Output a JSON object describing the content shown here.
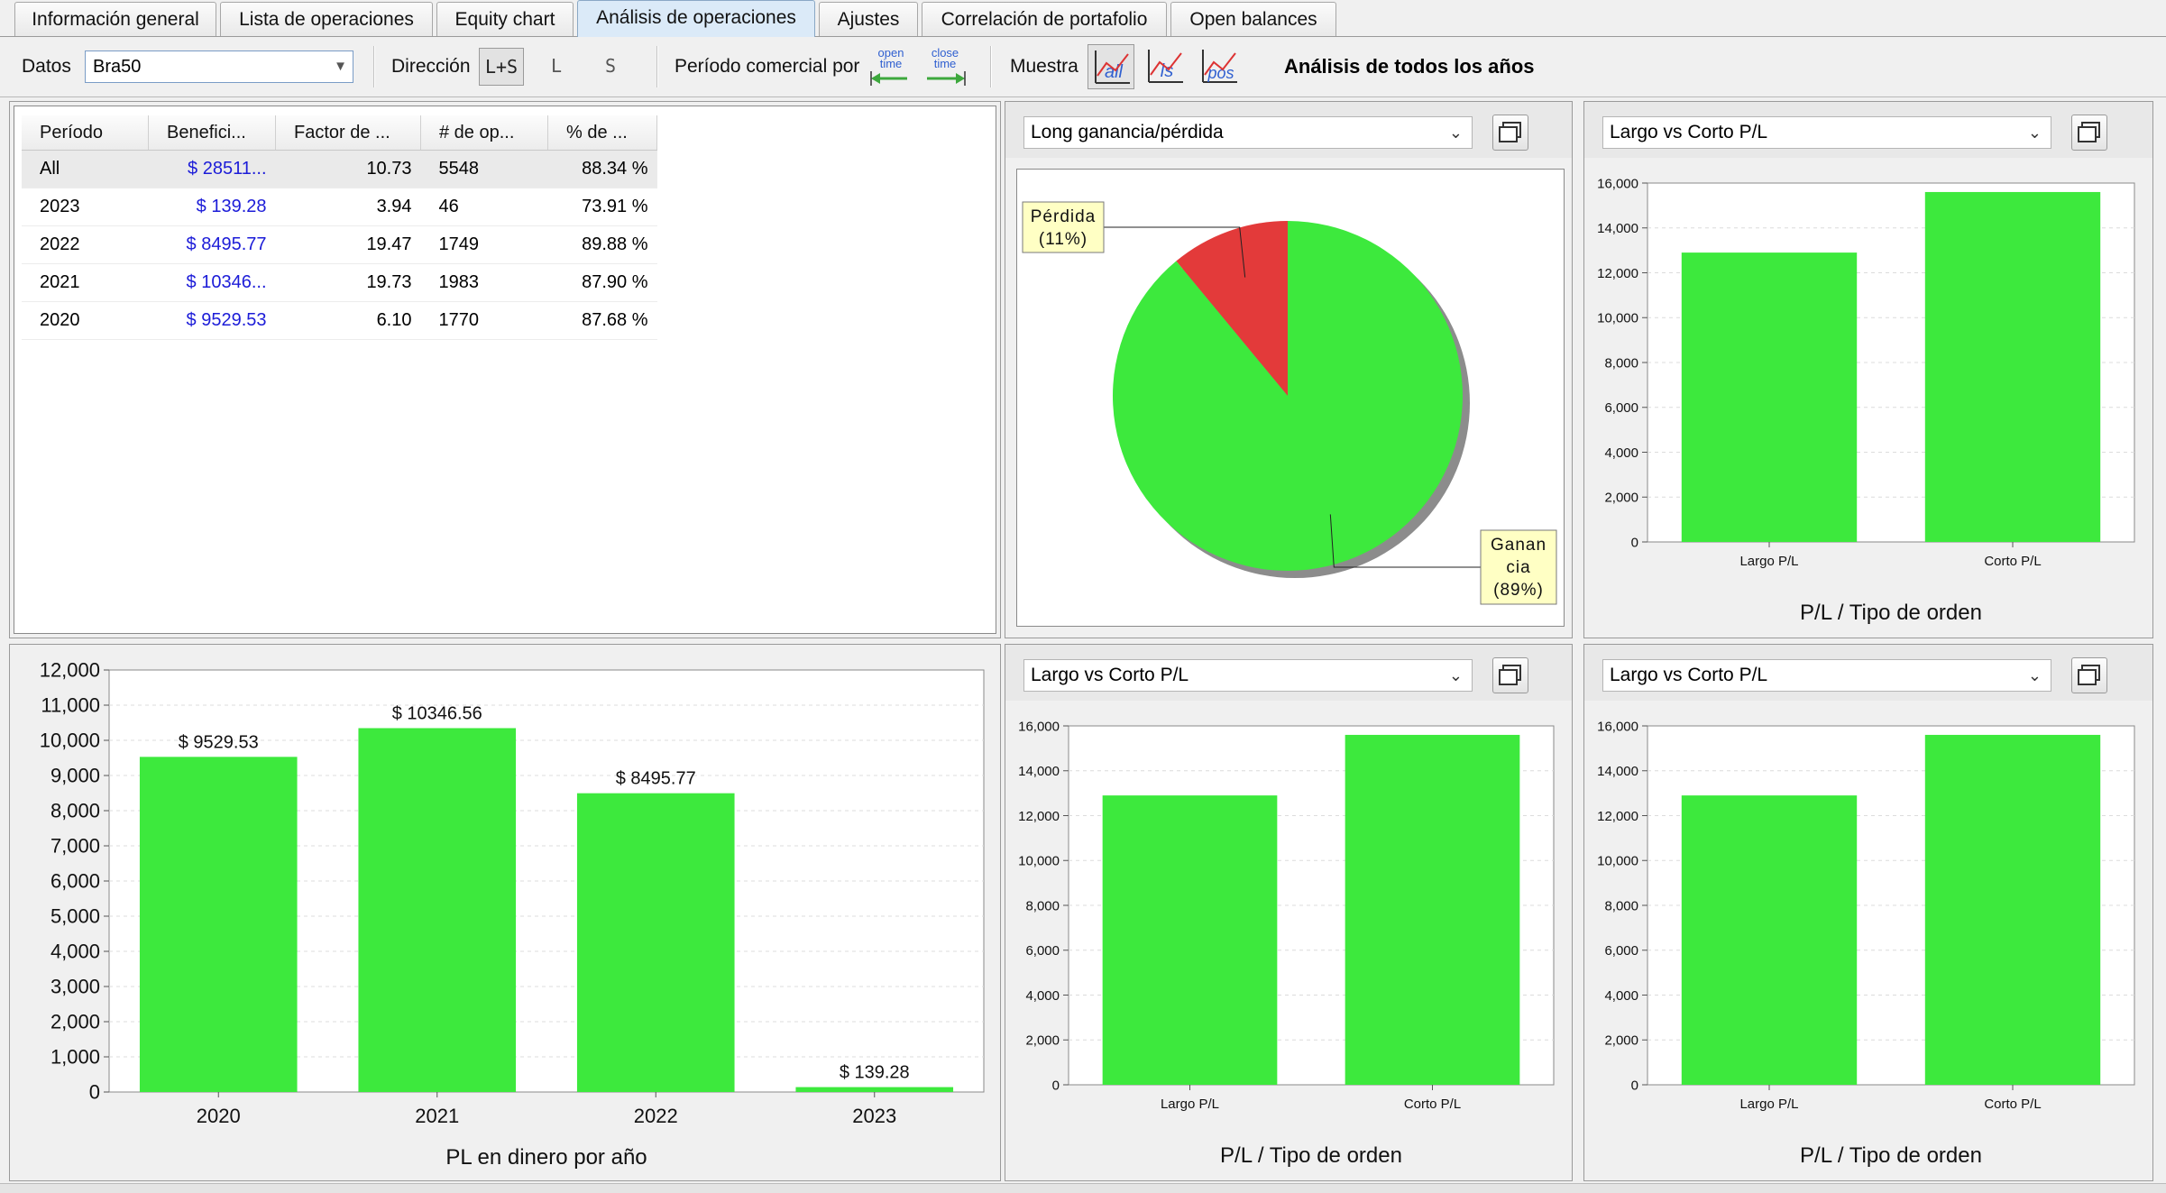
{
  "tabs": [
    {
      "label": "Información general",
      "active": false
    },
    {
      "label": "Lista de operaciones",
      "active": false
    },
    {
      "label": "Equity chart",
      "active": false
    },
    {
      "label": "Análisis de operaciones",
      "active": true
    },
    {
      "label": "Ajustes",
      "active": false
    },
    {
      "label": "Correlación de portafolio",
      "active": false
    },
    {
      "label": "Open balances",
      "active": false
    }
  ],
  "toolbar": {
    "data_label": "Datos",
    "data_value": "Bra50",
    "direction_label": "Dirección",
    "direction_options": [
      "L+S",
      "L",
      "S"
    ],
    "direction_selected": "L+S",
    "period_label": "Período comercial por",
    "period_open_icon_text": [
      "open",
      "time"
    ],
    "period_close_icon_text": [
      "close",
      "time"
    ],
    "show_label": "Muestra",
    "show_icon_texts": [
      "all",
      "ls",
      "pos"
    ],
    "analysis_title": "Análisis de todos los años"
  },
  "table": {
    "headers": [
      "Período",
      "Benefici...",
      "Factor de ...",
      "# de op...",
      "% de ..."
    ],
    "rows": [
      {
        "period": "All",
        "profit": "$ 28511...",
        "factor": "10.73",
        "trades": "5548",
        "pct": "88.34 %"
      },
      {
        "period": "2023",
        "profit": "$ 139.28",
        "factor": "3.94",
        "trades": "46",
        "pct": "73.91 %"
      },
      {
        "period": "2022",
        "profit": "$ 8495.77",
        "factor": "19.47",
        "trades": "1749",
        "pct": "89.88 %"
      },
      {
        "period": "2021",
        "profit": "$ 10346...",
        "factor": "19.73",
        "trades": "1983",
        "pct": "87.90 %"
      },
      {
        "period": "2020",
        "profit": "$ 9529.53",
        "factor": "6.10",
        "trades": "1770",
        "pct": "87.68 %"
      }
    ]
  },
  "colors": {
    "bar": "#3de93d",
    "loss": "#e33a3a",
    "gain": "#3de93d",
    "tooltip": "#ffffc4"
  },
  "pie_panel": {
    "selector": "Long ganancia/pérdida"
  },
  "bar_panels": [
    {
      "selector": "Largo vs Corto P/L"
    },
    {
      "selector": "Largo vs Corto P/L"
    },
    {
      "selector": "Largo vs Corto P/L"
    }
  ],
  "chart_data": [
    {
      "type": "pie",
      "labels": [
        "Pérdida",
        "Ganancia"
      ],
      "display_labels": [
        [
          "Pérdida",
          "(11%)"
        ],
        [
          "Ganan",
          "cia",
          "(89%)"
        ]
      ],
      "values": [
        11,
        89
      ]
    },
    {
      "type": "bar",
      "categories": [
        "Largo P/L",
        "Corto P/L"
      ],
      "values": [
        12900,
        15600
      ],
      "xlabel": "P/L / Tipo de orden",
      "ylim": [
        0,
        16000
      ],
      "yticks": [
        "0",
        "2,000",
        "4,000",
        "6,000",
        "8,000",
        "10,000",
        "12,000",
        "14,000",
        "16,000"
      ],
      "grid": true
    },
    {
      "type": "bar",
      "categories": [
        "2020",
        "2021",
        "2022",
        "2023"
      ],
      "values": [
        9529.53,
        10346.56,
        8495.77,
        139.28
      ],
      "data_labels": [
        "$ 9529.53",
        "$ 10346.56",
        "$ 8495.77",
        "$ 139.28"
      ],
      "xlabel": "PL en dinero por año",
      "ylim": [
        0,
        12000
      ],
      "yticks": [
        "0",
        "1,000",
        "2,000",
        "3,000",
        "4,000",
        "5,000",
        "6,000",
        "7,000",
        "8,000",
        "9,000",
        "10,000",
        "11,000",
        "12,000"
      ],
      "grid": true
    },
    {
      "type": "bar",
      "categories": [
        "Largo P/L",
        "Corto P/L"
      ],
      "values": [
        12900,
        15600
      ],
      "xlabel": "P/L / Tipo de orden",
      "ylim": [
        0,
        16000
      ],
      "yticks": [
        "0",
        "2,000",
        "4,000",
        "6,000",
        "8,000",
        "10,000",
        "12,000",
        "14,000",
        "16,000"
      ],
      "grid": true
    },
    {
      "type": "bar",
      "categories": [
        "Largo P/L",
        "Corto P/L"
      ],
      "values": [
        12900,
        15600
      ],
      "xlabel": "P/L / Tipo de orden",
      "ylim": [
        0,
        16000
      ],
      "yticks": [
        "0",
        "2,000",
        "4,000",
        "6,000",
        "8,000",
        "10,000",
        "12,000",
        "14,000",
        "16,000"
      ],
      "grid": true
    }
  ]
}
